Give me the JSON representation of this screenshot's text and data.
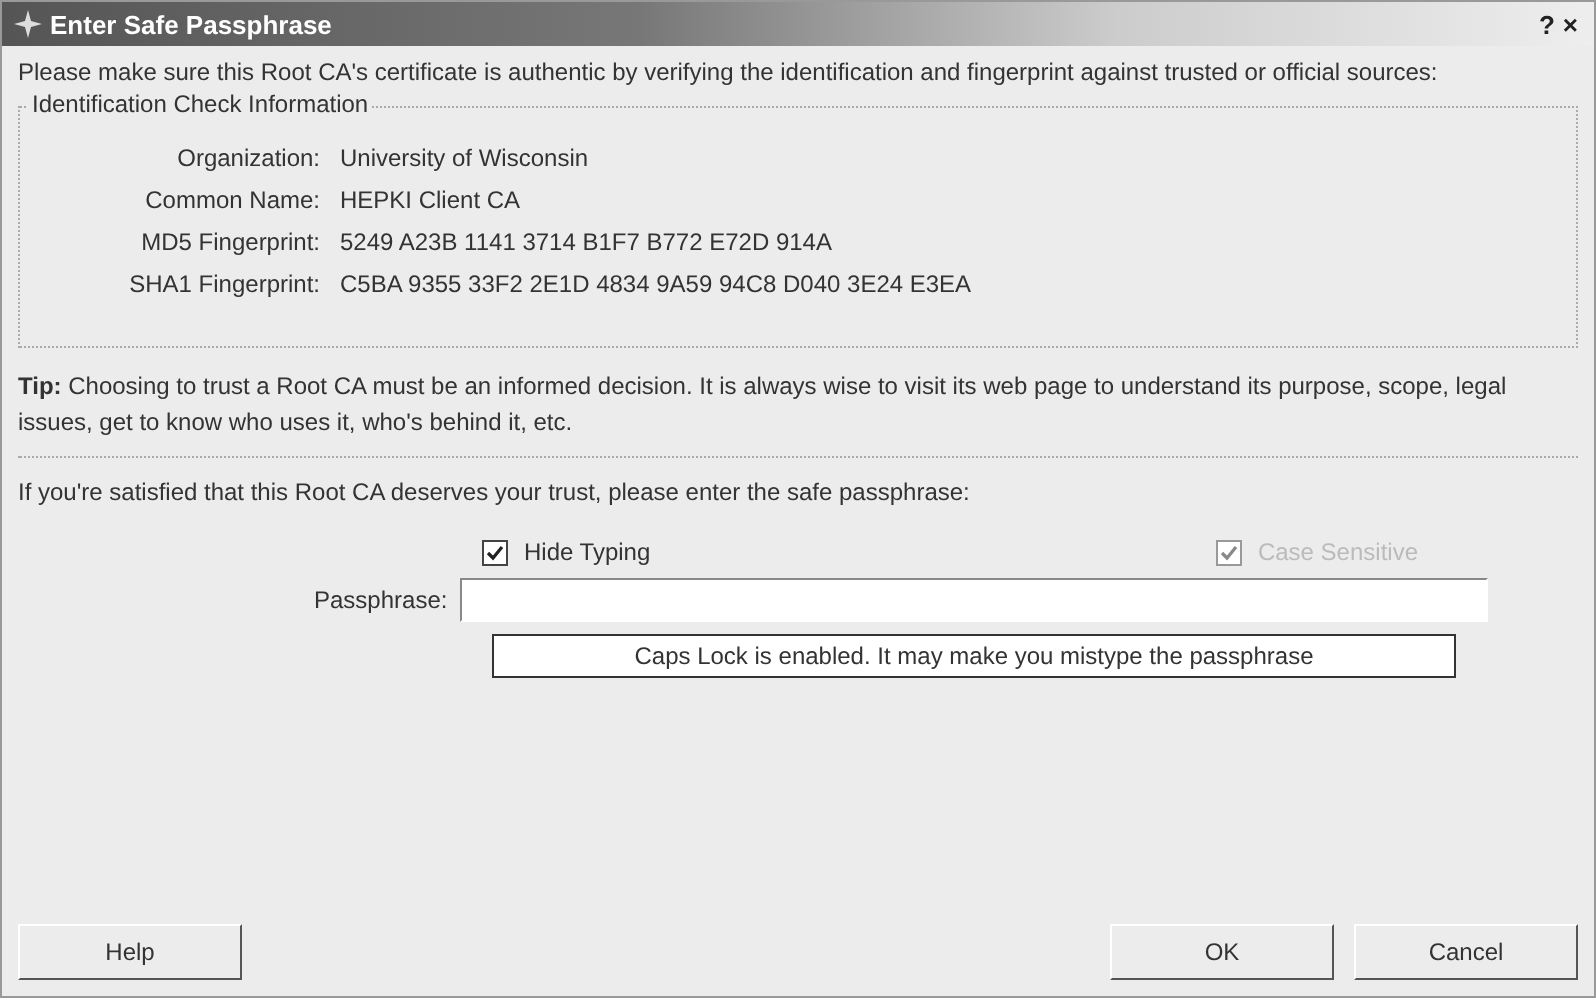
{
  "window": {
    "title": "Enter Safe Passphrase",
    "controls": [
      "?",
      "×"
    ]
  },
  "intro": "Please make sure this Root CA's certificate is authentic by verifying the identification and fingerprint against trusted or official sources:",
  "group": {
    "title": "Identification Check Information",
    "fields": [
      {
        "label": "Organization:",
        "value": "University of Wisconsin"
      },
      {
        "label": "Common Name:",
        "value": "HEPKI Client CA"
      },
      {
        "label": "MD5 Fingerprint:",
        "value": "5249 A23B 1141 3714 B1F7 B772 E72D 914A"
      },
      {
        "label": "SHA1 Fingerprint:",
        "value": "C5BA 9355 33F2 2E1D 4834 9A59 94C8 D040 3E24 E3EA"
      }
    ]
  },
  "tip": "**Tip:** Choosing to trust a Root CA must be an informed decision. It is always wise to visit its web page to understand its purpose, scope, legal issues, get to know who uses it, who's behind it, etc.",
  "prompt": "If you're satisfied that this Root CA deserves your trust, please enter the safe passphrase:",
  "checkboxes": [
    {
      "label": "Hide Typing",
      "checked": true,
      "disabled": false
    },
    {
      "label": "Case Sensitive",
      "checked": true,
      "disabled": true
    }
  ],
  "passphrase": {
    "label": "Passphrase:"
  },
  "warning": "Caps Lock is enabled. It may make you mistype the passphrase",
  "buttons": [
    {
      "label": "Help",
      "kind": "left"
    },
    {
      "label": "OK",
      "kind": "right"
    },
    {
      "label": "Cancel",
      "kind": "right"
    }
  ]
}
